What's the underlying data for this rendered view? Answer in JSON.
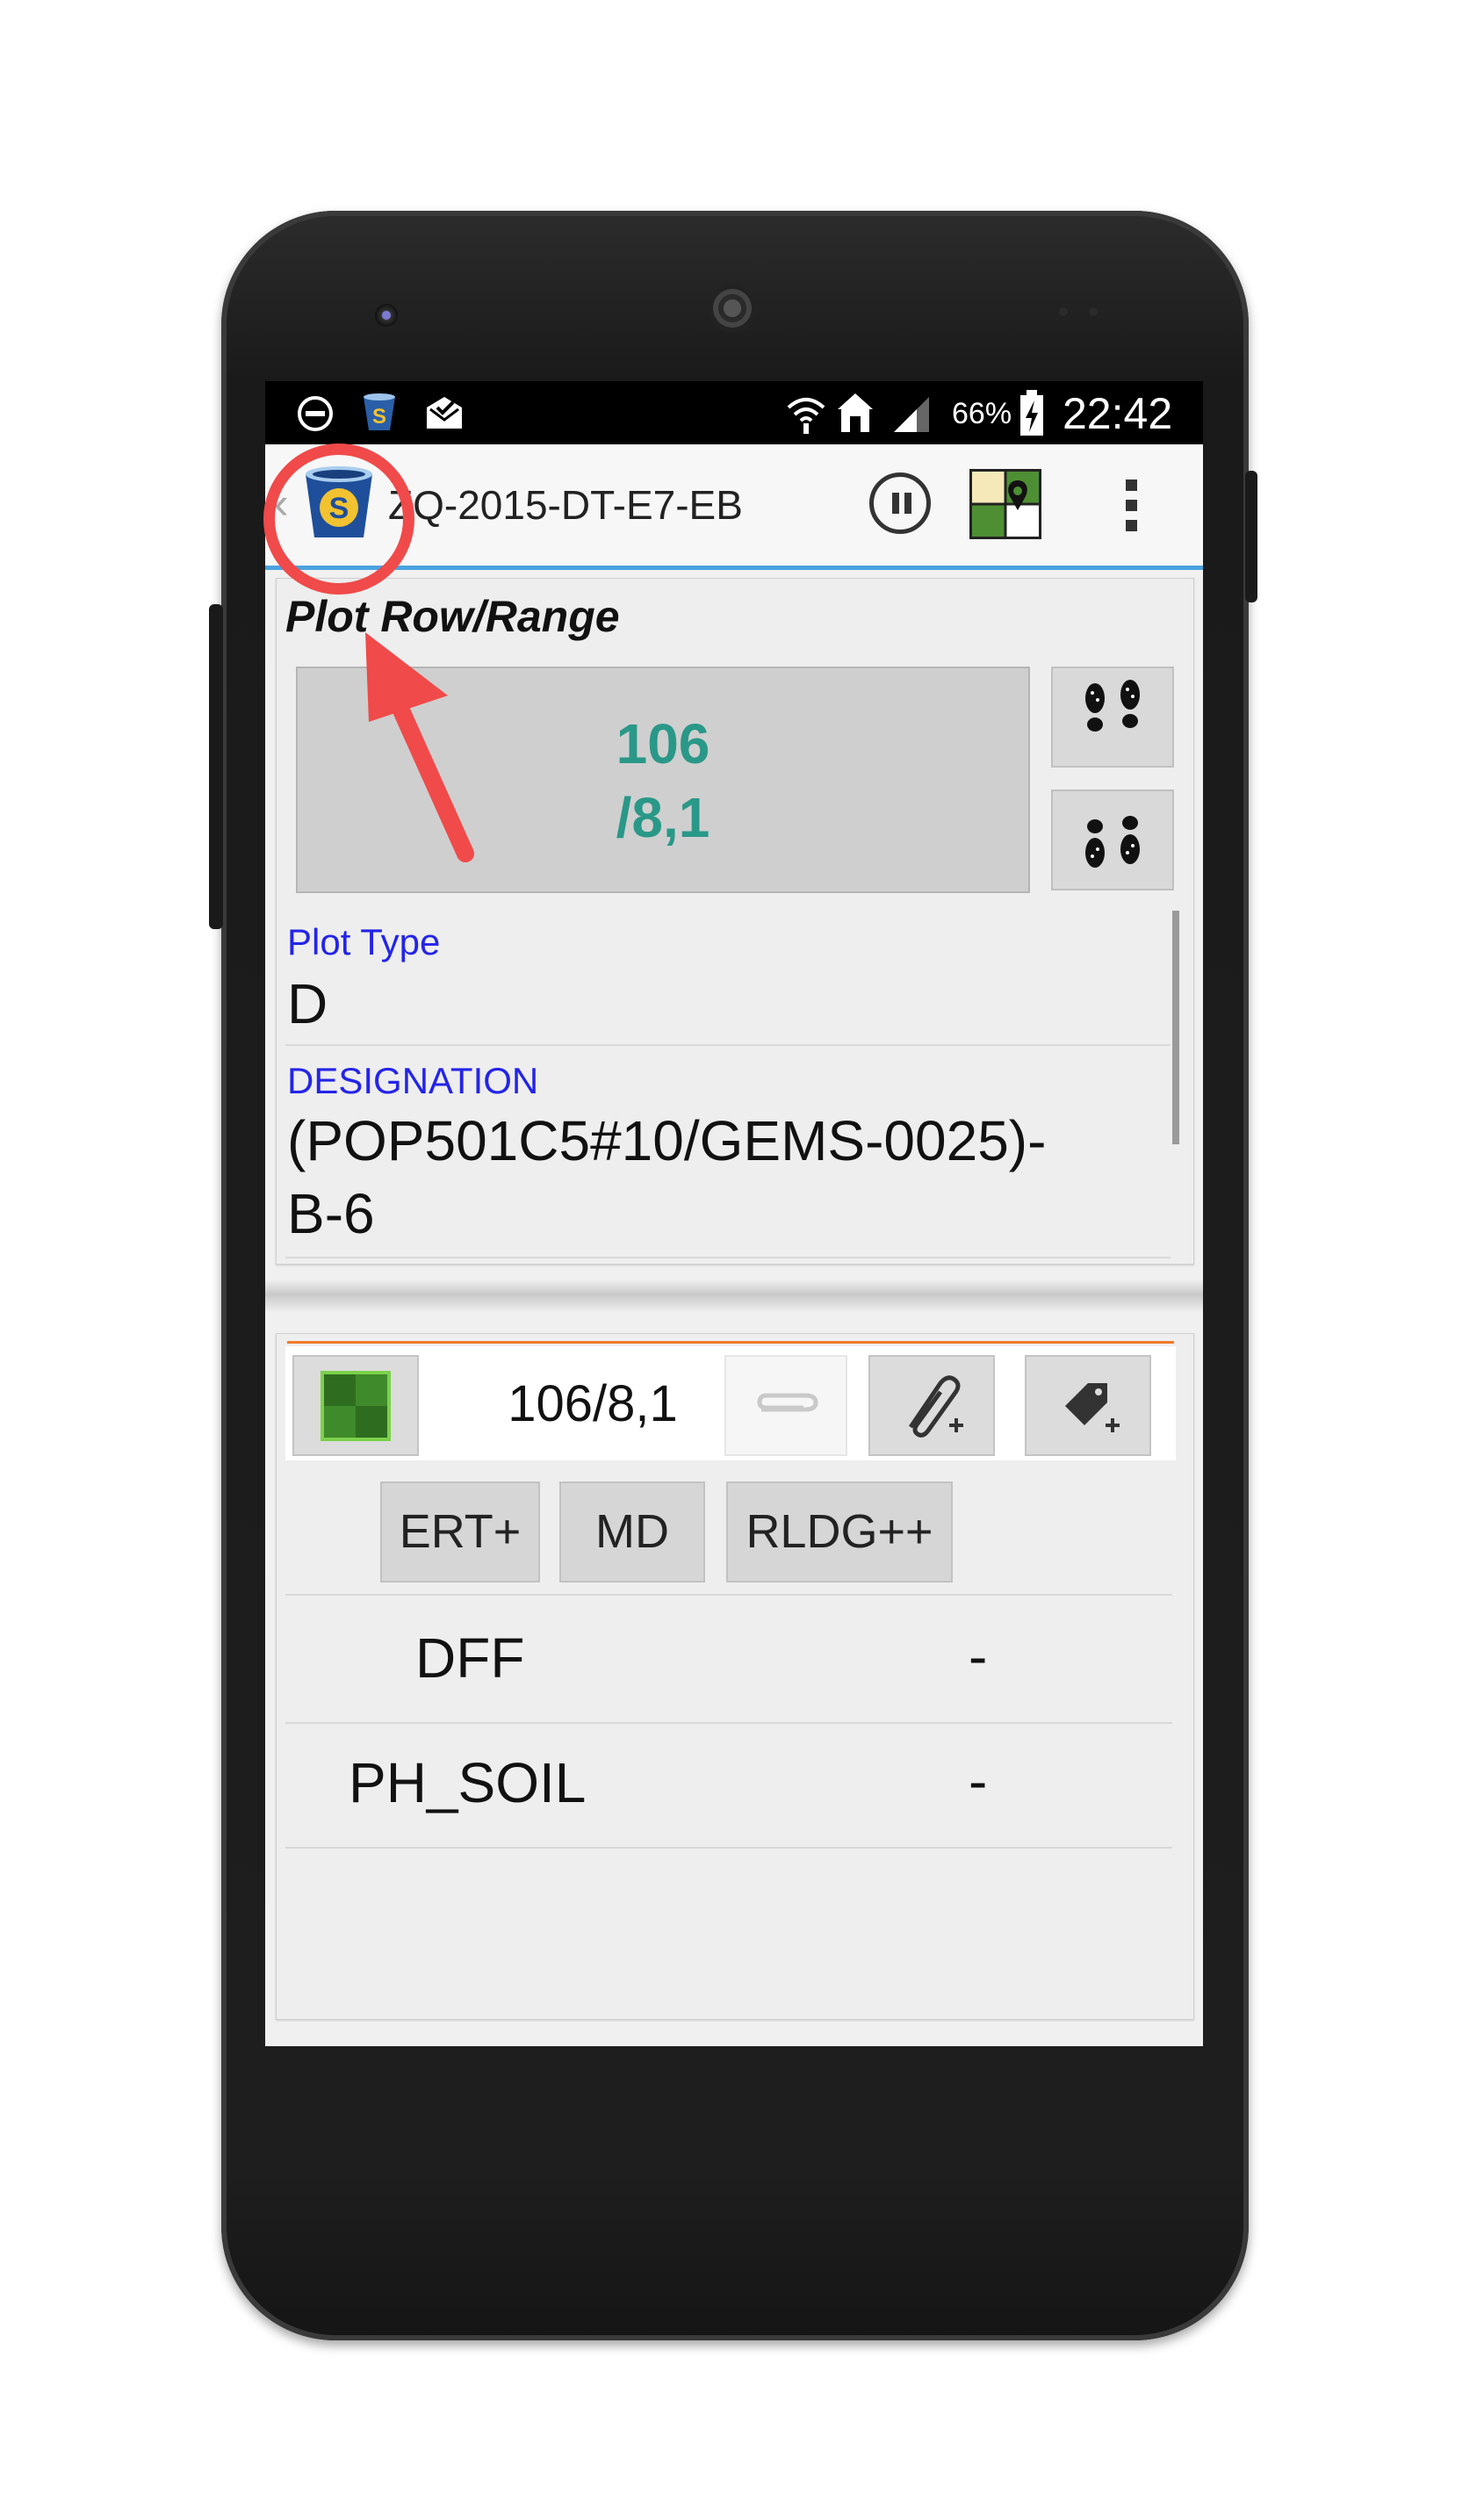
{
  "status_bar": {
    "battery": "66%",
    "time": "22:42"
  },
  "action_bar": {
    "title": "ZQ-2015-DT-E7-EB",
    "back_glyph": "‹",
    "icons": [
      "app-logo-icon",
      "pause-icon",
      "map-location-icon",
      "overflow-menu-icon"
    ]
  },
  "plot_card": {
    "header": "Plot Row/Range",
    "plot_number": "106",
    "plot_rowrange": "/8,1",
    "fields": [
      {
        "label": "Plot Type",
        "value": "D"
      },
      {
        "label": "DESIGNATION",
        "value_line1": "(POP501C5#10/GEMS-0025)-",
        "value_line2": "B-6"
      }
    ]
  },
  "trait_card": {
    "plot_id": "106/8,1",
    "buttons": [
      "ERT+",
      "MD",
      "RLDG++"
    ],
    "traits": [
      {
        "name": "DFF",
        "value": "-"
      },
      {
        "name": "PH_SOIL",
        "value": "-"
      }
    ]
  },
  "colors": {
    "plot_value": "#2a9888",
    "field_label": "#2424e8",
    "action_bar_accent": "#4aa3df",
    "annotation": "#f04a4a",
    "card_accent": "#f07b2a"
  }
}
